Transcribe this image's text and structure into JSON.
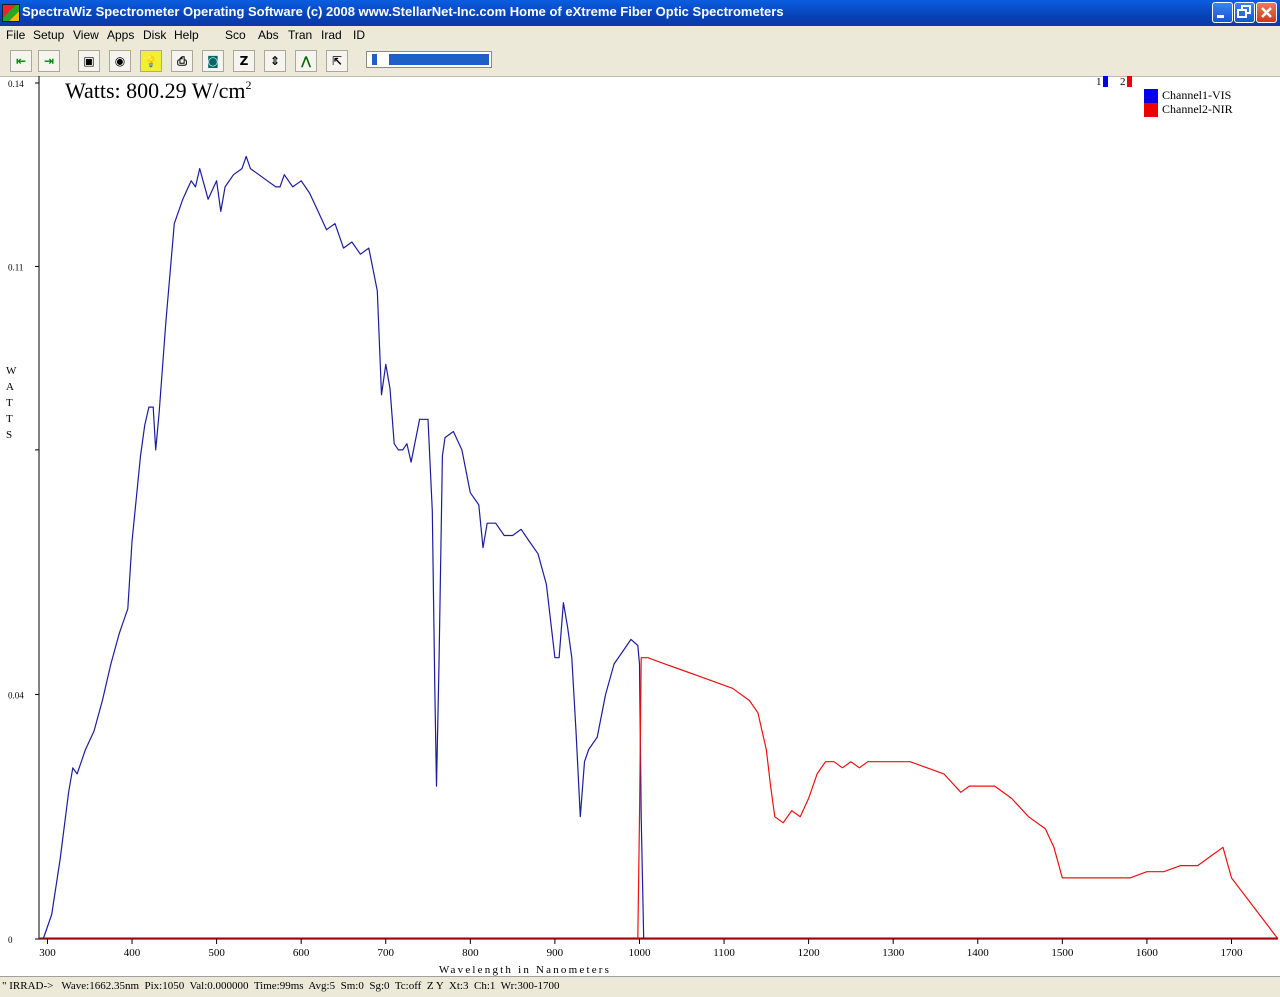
{
  "window": {
    "title": "SpectraWiz  Spectrometer Operating Software (c) 2008  www.StellarNet-Inc.com  Home of eXtreme Fiber Optic Spectrometers",
    "icon": "spectrawiz-app-icon"
  },
  "menu": [
    "File",
    "Setup",
    "View",
    "Apps",
    "Disk",
    "Help",
    "Sco",
    "Abs",
    "Tran",
    "Irad",
    "ID"
  ],
  "toolbar": {
    "buttons": [
      {
        "name": "scroll-left-icon",
        "glyph": "⇤"
      },
      {
        "name": "scroll-right-icon",
        "glyph": "⇥"
      },
      {
        "name": "save-icon",
        "glyph": "▣"
      },
      {
        "name": "detector-icon",
        "glyph": "◉"
      },
      {
        "name": "lamp-icon",
        "glyph": "💡"
      },
      {
        "name": "print-icon",
        "glyph": "⎙"
      },
      {
        "name": "camera-icon",
        "glyph": "◙"
      },
      {
        "name": "zoom-z-icon",
        "glyph": "Z"
      },
      {
        "name": "autoscale-icon",
        "glyph": "⇕"
      },
      {
        "name": "peak-icon",
        "glyph": "⋀"
      },
      {
        "name": "export-icon",
        "glyph": "⇱"
      }
    ],
    "slider_level": 0.0
  },
  "plot": {
    "power_label": "Watts: 800.29 W/cm",
    "power_exponent": "2",
    "ylabel": "WATTS",
    "xlabel": "Wavelength in Nanometers",
    "channel_tabs": [
      "1",
      "2"
    ],
    "legend": [
      {
        "name": "Channel1-VIS",
        "color": "#0000ee"
      },
      {
        "name": "Channel2-NIR",
        "color": "#ee0000"
      }
    ]
  },
  "chart_data": {
    "type": "line",
    "title": "",
    "xlabel": "Wavelength in Nanometers",
    "ylabel": "WATTS",
    "xlim": [
      290,
      1755
    ],
    "ylim": [
      0,
      0.14
    ],
    "x_ticks": [
      300,
      400,
      500,
      600,
      700,
      800,
      900,
      1000,
      1100,
      1200,
      1300,
      1400,
      1500,
      1600,
      1700
    ],
    "y_ticks": [
      {
        "v": 0.14,
        "label": "0.14"
      },
      {
        "v": 0.11,
        "label": "0.11"
      },
      {
        "v": 0.08,
        "label": ""
      },
      {
        "v": 0.04,
        "label": "0.04"
      },
      {
        "v": 0.0,
        "label": "0"
      }
    ],
    "series": [
      {
        "name": "Channel1-VIS",
        "color": "#1c1ca0",
        "x": [
          295,
          305,
          315,
          325,
          330,
          335,
          345,
          355,
          365,
          375,
          385,
          395,
          400,
          410,
          415,
          420,
          425,
          428,
          432,
          440,
          450,
          460,
          470,
          475,
          480,
          490,
          500,
          505,
          510,
          520,
          530,
          535,
          540,
          550,
          560,
          570,
          575,
          580,
          590,
          600,
          610,
          620,
          630,
          640,
          650,
          660,
          670,
          680,
          690,
          695,
          700,
          705,
          710,
          715,
          720,
          725,
          730,
          740,
          750,
          755,
          758,
          760,
          763,
          767,
          770,
          780,
          790,
          800,
          810,
          815,
          820,
          830,
          840,
          850,
          860,
          870,
          880,
          890,
          900,
          905,
          910,
          915,
          920,
          925,
          930,
          935,
          940,
          950,
          960,
          970,
          980,
          990,
          998,
          1000,
          1002,
          1005
        ],
        "y": [
          0.0,
          0.004,
          0.013,
          0.024,
          0.028,
          0.027,
          0.031,
          0.034,
          0.039,
          0.045,
          0.05,
          0.054,
          0.065,
          0.079,
          0.084,
          0.087,
          0.087,
          0.08,
          0.086,
          0.101,
          0.117,
          0.121,
          0.124,
          0.123,
          0.126,
          0.121,
          0.124,
          0.119,
          0.123,
          0.125,
          0.126,
          0.128,
          0.126,
          0.125,
          0.124,
          0.123,
          0.123,
          0.125,
          0.123,
          0.124,
          0.122,
          0.119,
          0.116,
          0.117,
          0.113,
          0.114,
          0.112,
          0.113,
          0.106,
          0.089,
          0.094,
          0.09,
          0.081,
          0.08,
          0.08,
          0.081,
          0.078,
          0.085,
          0.085,
          0.07,
          0.041,
          0.025,
          0.045,
          0.079,
          0.082,
          0.083,
          0.08,
          0.073,
          0.071,
          0.064,
          0.068,
          0.068,
          0.066,
          0.066,
          0.067,
          0.065,
          0.063,
          0.058,
          0.046,
          0.046,
          0.055,
          0.051,
          0.046,
          0.034,
          0.02,
          0.029,
          0.031,
          0.033,
          0.04,
          0.045,
          0.047,
          0.049,
          0.048,
          0.045,
          0.02,
          0.0
        ]
      },
      {
        "name": "Channel2-NIR",
        "color": "#ee1010",
        "x": [
          998,
          1000,
          1002,
          1010,
          1030,
          1050,
          1070,
          1090,
          1110,
          1130,
          1140,
          1150,
          1155,
          1160,
          1170,
          1180,
          1190,
          1200,
          1210,
          1220,
          1230,
          1240,
          1250,
          1260,
          1270,
          1280,
          1300,
          1320,
          1340,
          1360,
          1380,
          1390,
          1400,
          1420,
          1440,
          1460,
          1480,
          1490,
          1500,
          1520,
          1540,
          1560,
          1580,
          1600,
          1620,
          1640,
          1660,
          1680,
          1690,
          1700,
          1755
        ],
        "y": [
          0.0,
          0.02,
          0.046,
          0.046,
          0.045,
          0.044,
          0.043,
          0.042,
          0.041,
          0.039,
          0.037,
          0.031,
          0.025,
          0.02,
          0.019,
          0.021,
          0.02,
          0.023,
          0.027,
          0.029,
          0.029,
          0.028,
          0.029,
          0.028,
          0.029,
          0.029,
          0.029,
          0.029,
          0.028,
          0.027,
          0.024,
          0.025,
          0.025,
          0.025,
          0.023,
          0.02,
          0.018,
          0.015,
          0.01,
          0.01,
          0.01,
          0.01,
          0.01,
          0.011,
          0.011,
          0.012,
          0.012,
          0.014,
          0.015,
          0.01,
          0.0
        ]
      }
    ]
  },
  "status": {
    "text": "\" IRRAD->   Wave:1662.35nm  Pix:1050  Val:0.000000  Time:99ms  Avg:5  Sm:0  Sg:0  Tc:off  Z Y  Xt:3  Ch:1  Wr:300-1700"
  }
}
